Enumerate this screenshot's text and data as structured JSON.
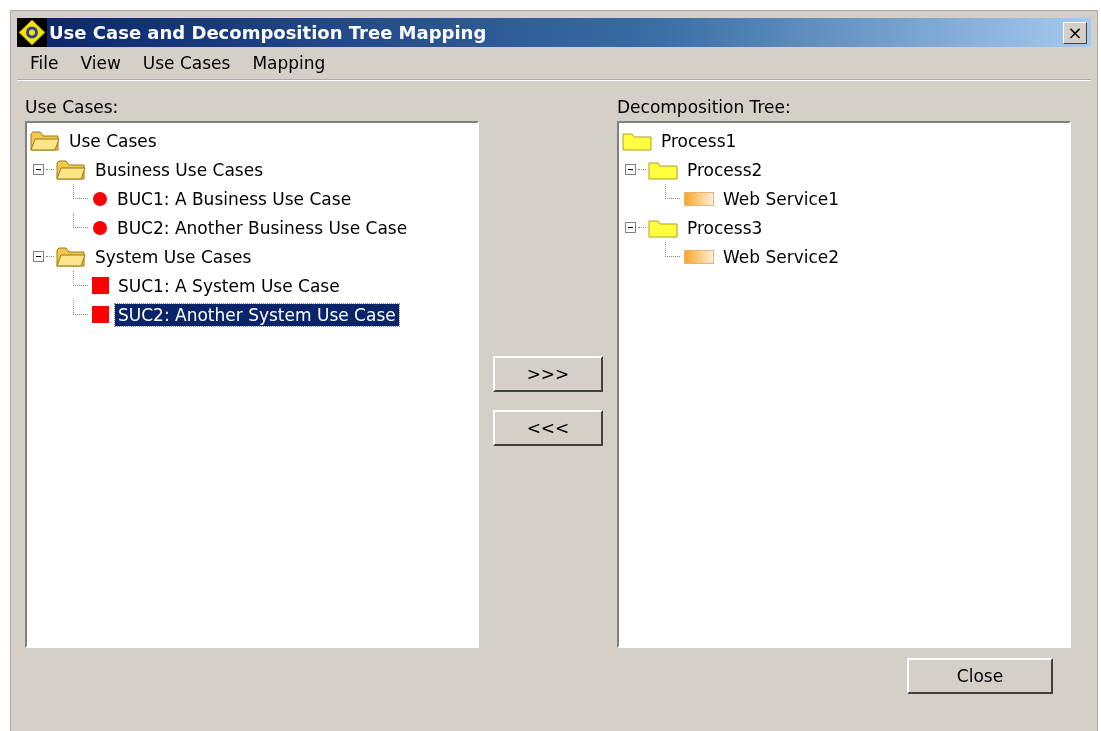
{
  "window": {
    "title": "Use Case and Decomposition Tree Mapping",
    "close_label": "×"
  },
  "menu": [
    {
      "label": "File"
    },
    {
      "label": "View"
    },
    {
      "label": "Use Cases"
    },
    {
      "label": "Mapping"
    }
  ],
  "use_cases": {
    "label": "Use Cases:",
    "tree": {
      "label": "Use Cases",
      "kind": "folder",
      "selected": false,
      "children": [
        {
          "label": "Business Use Cases",
          "kind": "folder",
          "selected": false,
          "expanded": true,
          "children": [
            {
              "label": "BUC1: A Business Use Case",
              "kind": "business",
              "selected": false
            },
            {
              "label": "BUC2: Another Business Use Case",
              "kind": "business",
              "selected": false
            }
          ]
        },
        {
          "label": "System Use Cases",
          "kind": "folder",
          "selected": false,
          "expanded": true,
          "children": [
            {
              "label": "SUC1: A System Use Case",
              "kind": "system",
              "selected": false
            },
            {
              "label": "SUC2: Another System Use Case",
              "kind": "system",
              "selected": true
            }
          ]
        }
      ]
    }
  },
  "buttons": [
    {
      "label": ">>>"
    },
    {
      "label": "<<<"
    }
  ],
  "decomposition": {
    "label": "Decomposition Tree:",
    "tree": {
      "label": "Process1",
      "kind": "process",
      "selected": false,
      "children": [
        {
          "label": "Process2",
          "kind": "process",
          "selected": false,
          "expanded": true,
          "children": [
            {
              "label": "Web Service1",
              "kind": "service",
              "selected": false
            }
          ]
        },
        {
          "label": "Process3",
          "kind": "process",
          "selected": false,
          "expanded": true,
          "children": [
            {
              "label": "Web Service2",
              "kind": "service",
              "selected": false
            }
          ]
        }
      ]
    }
  },
  "close_button": {
    "label": "Close"
  }
}
